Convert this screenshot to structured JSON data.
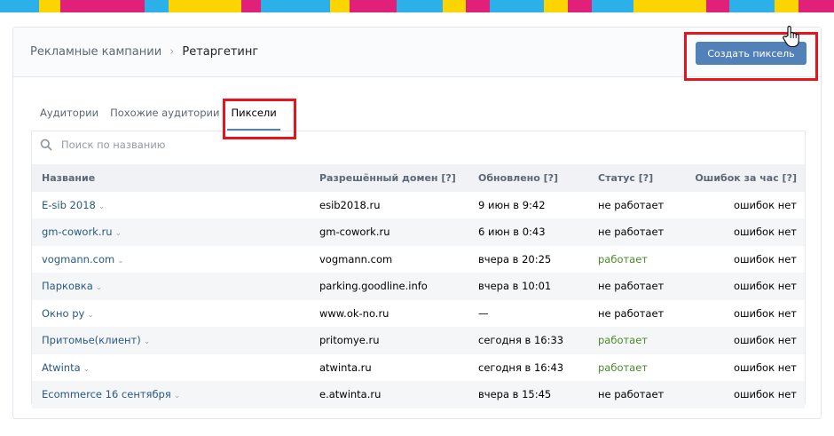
{
  "stripe_colors": [
    "#2bb0e9",
    "#fcd501",
    "#e1207a",
    "#2bb0e9",
    "#fcd501",
    "#e1207a",
    "#2bb0e9",
    "#fcd501",
    "#e1207a",
    "#2bb0e9",
    "#fcd501",
    "#e1207a",
    "#2bb0e9",
    "#fcd501",
    "#e1207a",
    "#2bb0e9",
    "#fcd501",
    "#e1207a",
    "#2bb0e9",
    "#fcd501",
    "#e1207a"
  ],
  "breadcrumb": {
    "parent": "Рекламные кампании",
    "separator": "›",
    "current": "Ретаргетинг"
  },
  "create_button": "Создать пиксель",
  "tabs": [
    {
      "label": "Аудитории",
      "active": false
    },
    {
      "label": "Похожие аудитории",
      "active": false
    },
    {
      "label": "Пиксели",
      "active": true
    }
  ],
  "search": {
    "placeholder": "Поиск по названию",
    "value": ""
  },
  "table": {
    "headers": [
      "Название",
      "Разрешённый домен [?]",
      "Обновлено [?]",
      "Статус [?]",
      "Ошибок за час [?]"
    ],
    "rows": [
      {
        "name": "E-sib 2018",
        "domain": "esib2018.ru",
        "updated": "9 июн в 9:42",
        "status": "не работает",
        "errors": "ошибок нет"
      },
      {
        "name": "gm-cowork.ru",
        "domain": "gm-cowork.ru",
        "updated": "6 июн в 0:43",
        "status": "не работает",
        "errors": "ошибок нет"
      },
      {
        "name": "vogmann.com",
        "domain": "vogmann.com",
        "updated": "вчера в 20:25",
        "status": "работает",
        "errors": "ошибок нет"
      },
      {
        "name": "Парковка",
        "domain": "parking.goodline.info",
        "updated": "вчера в 10:01",
        "status": "не работает",
        "errors": "ошибок нет"
      },
      {
        "name": "Окно ру",
        "domain": "www.ok-no.ru",
        "updated": "—",
        "status": "не работает",
        "errors": "ошибок нет"
      },
      {
        "name": "Притомье(клиент)",
        "domain": "pritomye.ru",
        "updated": "сегодня в 16:33",
        "status": "работает",
        "errors": "ошибок нет"
      },
      {
        "name": "Atwinta",
        "domain": "atwinta.ru",
        "updated": "сегодня в 16:43",
        "status": "работает",
        "errors": "ошибок нет"
      },
      {
        "name": "Ecommerce 16 сентября",
        "domain": "e.atwinta.ru",
        "updated": "вчера в 15:45",
        "status": "не работает",
        "errors": "ошибок нет"
      }
    ]
  }
}
